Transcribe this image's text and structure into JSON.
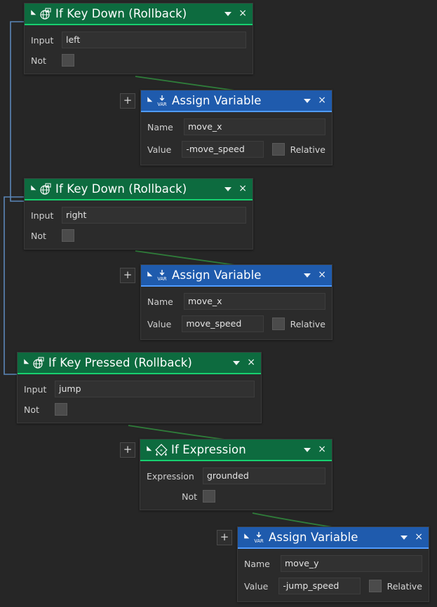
{
  "editor": {
    "background_color": "#262626",
    "green_accent": "#0d6b3f",
    "green_underline": "#17d06f",
    "blue_accent": "#1f5bad",
    "blue_underline": "#4f9bff",
    "wire_green": "#2f7d3a",
    "wire_blue": "#5a86b8"
  },
  "add_button_label": "+",
  "dropdown_caret": "▾",
  "close_label": "×",
  "nodes": [
    {
      "id": "keydown-left",
      "title": "If Key Down (Rollback)",
      "icon": "key-rollback-icon",
      "color": "green",
      "fields": [
        {
          "label": "Input",
          "type": "text",
          "value": "left"
        },
        {
          "label": "Not",
          "type": "checkbox",
          "checked": false
        }
      ]
    },
    {
      "id": "assign-1",
      "title": "Assign Variable",
      "icon": "var-assign-icon",
      "color": "blue",
      "fields": [
        {
          "label": "Name",
          "type": "text",
          "value": "move_x"
        },
        {
          "label": "Value",
          "type": "text",
          "value": "-move_speed",
          "extra_label": "Relative",
          "extra_checked": false
        }
      ]
    },
    {
      "id": "keydown-right",
      "title": "If Key Down (Rollback)",
      "icon": "key-rollback-icon",
      "color": "green",
      "fields": [
        {
          "label": "Input",
          "type": "text",
          "value": "right"
        },
        {
          "label": "Not",
          "type": "checkbox",
          "checked": false
        }
      ]
    },
    {
      "id": "assign-2",
      "title": "Assign Variable",
      "icon": "var-assign-icon",
      "color": "blue",
      "fields": [
        {
          "label": "Name",
          "type": "text",
          "value": "move_x"
        },
        {
          "label": "Value",
          "type": "text",
          "value": "move_speed",
          "extra_label": "Relative",
          "extra_checked": false
        }
      ]
    },
    {
      "id": "keypressed",
      "title": "If Key Pressed (Rollback)",
      "icon": "key-rollback-icon",
      "color": "green",
      "fields": [
        {
          "label": "Input",
          "type": "text",
          "value": "jump"
        },
        {
          "label": "Not",
          "type": "checkbox",
          "checked": false
        }
      ]
    },
    {
      "id": "ifexpr",
      "title": "If Expression",
      "icon": "expression-icon",
      "color": "green",
      "fields": [
        {
          "label": "Expression",
          "type": "text",
          "value": "grounded"
        },
        {
          "label": "Not",
          "type": "checkbox",
          "checked": false
        }
      ]
    },
    {
      "id": "assign-3",
      "title": "Assign Variable",
      "icon": "var-assign-icon",
      "color": "blue",
      "fields": [
        {
          "label": "Name",
          "type": "text",
          "value": "move_y"
        },
        {
          "label": "Value",
          "type": "text",
          "value": "-jump_speed",
          "extra_label": "Relative",
          "extra_checked": false
        }
      ]
    }
  ],
  "labels": {
    "input": "Input",
    "not": "Not",
    "name": "Name",
    "value": "Value",
    "expression": "Expression",
    "relative": "Relative"
  },
  "values": {
    "key_left": "left",
    "key_right": "right",
    "key_jump": "jump",
    "var_move_x": "move_x",
    "var_move_y": "move_y",
    "val_neg_move_speed": "-move_speed",
    "val_move_speed": "move_speed",
    "val_neg_jump_speed": "-jump_speed",
    "expr_grounded": "grounded"
  },
  "titles": {
    "if_key_down": "If Key Down (Rollback)",
    "if_key_pressed": "If Key Pressed (Rollback)",
    "assign_variable": "Assign Variable",
    "if_expression": "If Expression"
  }
}
